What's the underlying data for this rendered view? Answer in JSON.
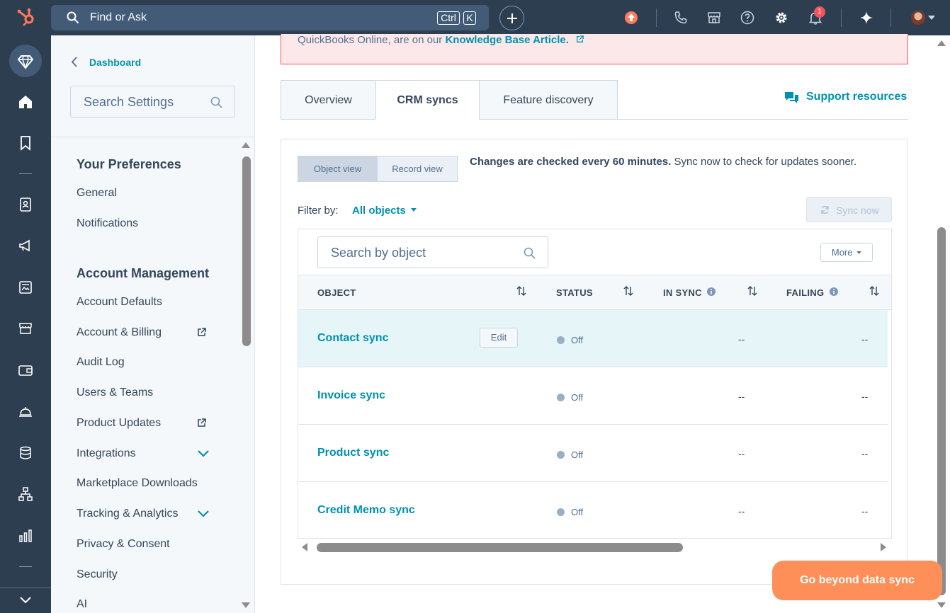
{
  "topbar": {
    "search_placeholder": "Find or Ask",
    "kbd_ctrl": "Ctrl",
    "kbd_k": "K",
    "notification_count": "1"
  },
  "sidebar": {
    "back_label": "Dashboard",
    "search_placeholder": "Search Settings",
    "sections": {
      "preferences_title": "Your Preferences",
      "account_title": "Account Management"
    },
    "items": {
      "general": "General",
      "notifications": "Notifications",
      "account_defaults": "Account Defaults",
      "account_billing": "Account & Billing",
      "audit_log": "Audit Log",
      "users_teams": "Users & Teams",
      "product_updates": "Product Updates",
      "integrations": "Integrations",
      "marketplace_downloads": "Marketplace Downloads",
      "tracking_analytics": "Tracking & Analytics",
      "privacy_consent": "Privacy & Consent",
      "security": "Security",
      "ai": "AI"
    }
  },
  "alert": {
    "text": "QuickBooks Online, are on our ",
    "link": "Knowledge Base Article."
  },
  "tabs": {
    "overview": "Overview",
    "crm_syncs": "CRM syncs",
    "feature_discovery": "Feature discovery"
  },
  "support_label": "Support resources",
  "panel": {
    "object_view": "Object view",
    "record_view": "Record view",
    "changes_bold": "Changes are checked every 60 minutes.",
    "changes_rest": " Sync now to check for updates sooner.",
    "filter_label": "Filter by:",
    "filter_value": "All objects",
    "sync_now": "Sync now",
    "object_search_placeholder": "Search by object",
    "more_label": "More",
    "columns": {
      "object": "OBJECT",
      "status": "STATUS",
      "in_sync": "IN SYNC",
      "failing": "FAILING"
    },
    "edit_label": "Edit",
    "rows": [
      {
        "name": "Contact sync",
        "status": "Off",
        "in_sync": "--",
        "failing": "--"
      },
      {
        "name": "Invoice sync",
        "status": "Off",
        "in_sync": "--",
        "failing": "--"
      },
      {
        "name": "Product sync",
        "status": "Off",
        "in_sync": "--",
        "failing": "--"
      },
      {
        "name": "Credit Memo sync",
        "status": "Off",
        "in_sync": "--",
        "failing": "--"
      }
    ]
  },
  "cta_label": "Go beyond data sync",
  "colors": {
    "topbar": "#2d3e50",
    "link": "#0091ae",
    "cta": "#ff8f59",
    "alert_border": "#f2545b"
  }
}
